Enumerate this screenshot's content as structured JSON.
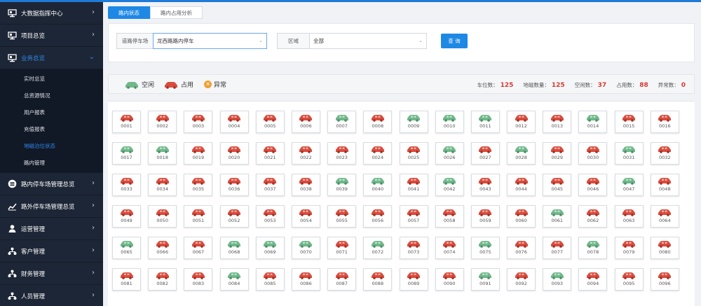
{
  "colors": {
    "occupied": "#d94b3c",
    "free": "#6fb88a",
    "accent": "#1e88e5",
    "sidebar_bg": "#1d2636"
  },
  "sidebar": {
    "items": [
      {
        "label": "大数据指挥中心",
        "icon": "monitor-icon"
      },
      {
        "label": "项目总览",
        "icon": "monitor-icon"
      },
      {
        "label": "业务总览",
        "icon": "monitor-icon",
        "active": true
      }
    ],
    "sub_items": [
      {
        "label": "实时总览"
      },
      {
        "label": "总资源情况"
      },
      {
        "label": "用户报表"
      },
      {
        "label": "充值报表"
      },
      {
        "label": "地磁泊位状态",
        "active": true
      },
      {
        "label": "路内管理"
      }
    ],
    "items_after": [
      {
        "label": "路内停车场管理总览",
        "icon": "parking-icon"
      },
      {
        "label": "路外停车场管理总览",
        "icon": "chart-icon"
      },
      {
        "label": "运营管理",
        "icon": "operator-icon"
      },
      {
        "label": "客户管理",
        "icon": "org-icon"
      },
      {
        "label": "财务管理",
        "icon": "org-icon"
      },
      {
        "label": "人员管理",
        "icon": "org-icon"
      }
    ]
  },
  "tabs": [
    "路内状态",
    "路内占用分析"
  ],
  "filter": {
    "lot_label": "道路停车场",
    "lot_value": "龙西路路内停车",
    "area_label": "区域",
    "area_value": "全部",
    "query_label": "查 询"
  },
  "legend": {
    "free": "空闲",
    "occupied": "占用",
    "abnormal": "异常"
  },
  "stats": {
    "spaces_label": "车位数：",
    "spaces": "125",
    "sensors_label": "地磁数量：",
    "sensors": "125",
    "free_label": "空闲数：",
    "free": "37",
    "occupied_label": "占用数：",
    "occupied": "88",
    "abnormal_label": "异常数：",
    "abnormal": "0"
  },
  "spots": [
    {
      "id": "0001",
      "s": "o"
    },
    {
      "id": "0002",
      "s": "o"
    },
    {
      "id": "0003",
      "s": "o"
    },
    {
      "id": "0004",
      "s": "o"
    },
    {
      "id": "0005",
      "s": "o"
    },
    {
      "id": "0006",
      "s": "o"
    },
    {
      "id": "0007",
      "s": "f"
    },
    {
      "id": "0008",
      "s": "o"
    },
    {
      "id": "0009",
      "s": "f"
    },
    {
      "id": "0010",
      "s": "f"
    },
    {
      "id": "0011",
      "s": "f"
    },
    {
      "id": "0012",
      "s": "o"
    },
    {
      "id": "0013",
      "s": "o"
    },
    {
      "id": "0014",
      "s": "f"
    },
    {
      "id": "0015",
      "s": "o"
    },
    {
      "id": "0016",
      "s": "o"
    },
    {
      "id": "0017",
      "s": "f"
    },
    {
      "id": "0018",
      "s": "f"
    },
    {
      "id": "0019",
      "s": "o"
    },
    {
      "id": "0020",
      "s": "o"
    },
    {
      "id": "0021",
      "s": "o"
    },
    {
      "id": "0022",
      "s": "o"
    },
    {
      "id": "0023",
      "s": "o"
    },
    {
      "id": "0024",
      "s": "o"
    },
    {
      "id": "0025",
      "s": "o"
    },
    {
      "id": "0026",
      "s": "f"
    },
    {
      "id": "0027",
      "s": "o"
    },
    {
      "id": "0028",
      "s": "f"
    },
    {
      "id": "0029",
      "s": "o"
    },
    {
      "id": "0030",
      "s": "o"
    },
    {
      "id": "0031",
      "s": "f"
    },
    {
      "id": "0032",
      "s": "o"
    },
    {
      "id": "0033",
      "s": "o"
    },
    {
      "id": "0034",
      "s": "o"
    },
    {
      "id": "0035",
      "s": "o"
    },
    {
      "id": "0036",
      "s": "o"
    },
    {
      "id": "0037",
      "s": "o"
    },
    {
      "id": "0038",
      "s": "o"
    },
    {
      "id": "0039",
      "s": "f"
    },
    {
      "id": "0040",
      "s": "f"
    },
    {
      "id": "0041",
      "s": "o"
    },
    {
      "id": "0042",
      "s": "f"
    },
    {
      "id": "0043",
      "s": "o"
    },
    {
      "id": "0044",
      "s": "o"
    },
    {
      "id": "0045",
      "s": "o"
    },
    {
      "id": "0046",
      "s": "o"
    },
    {
      "id": "0047",
      "s": "f"
    },
    {
      "id": "0048",
      "s": "o"
    },
    {
      "id": "0049",
      "s": "o"
    },
    {
      "id": "0050",
      "s": "o"
    },
    {
      "id": "0051",
      "s": "o"
    },
    {
      "id": "0052",
      "s": "o"
    },
    {
      "id": "0053",
      "s": "o"
    },
    {
      "id": "0054",
      "s": "o"
    },
    {
      "id": "0055",
      "s": "o"
    },
    {
      "id": "0056",
      "s": "o"
    },
    {
      "id": "0057",
      "s": "o"
    },
    {
      "id": "0058",
      "s": "o"
    },
    {
      "id": "0059",
      "s": "o"
    },
    {
      "id": "0060",
      "s": "o"
    },
    {
      "id": "0061",
      "s": "f"
    },
    {
      "id": "0062",
      "s": "o"
    },
    {
      "id": "0063",
      "s": "o"
    },
    {
      "id": "0064",
      "s": "o"
    },
    {
      "id": "0065",
      "s": "f"
    },
    {
      "id": "0066",
      "s": "o"
    },
    {
      "id": "0067",
      "s": "o"
    },
    {
      "id": "0068",
      "s": "f"
    },
    {
      "id": "0069",
      "s": "f"
    },
    {
      "id": "0070",
      "s": "f"
    },
    {
      "id": "0071",
      "s": "o"
    },
    {
      "id": "0072",
      "s": "f"
    },
    {
      "id": "0073",
      "s": "o"
    },
    {
      "id": "0074",
      "s": "o"
    },
    {
      "id": "0075",
      "s": "f"
    },
    {
      "id": "0076",
      "s": "o"
    },
    {
      "id": "0077",
      "s": "o"
    },
    {
      "id": "0078",
      "s": "f"
    },
    {
      "id": "0079",
      "s": "o"
    },
    {
      "id": "0080",
      "s": "o"
    },
    {
      "id": "0081",
      "s": "o"
    },
    {
      "id": "0082",
      "s": "o"
    },
    {
      "id": "0083",
      "s": "o"
    },
    {
      "id": "0084",
      "s": "f"
    },
    {
      "id": "0085",
      "s": "o"
    },
    {
      "id": "0086",
      "s": "o"
    },
    {
      "id": "0087",
      "s": "o"
    },
    {
      "id": "0088",
      "s": "o"
    },
    {
      "id": "0089",
      "s": "o"
    },
    {
      "id": "0090",
      "s": "o"
    },
    {
      "id": "0091",
      "s": "f"
    },
    {
      "id": "0092",
      "s": "o"
    },
    {
      "id": "0093",
      "s": "f"
    },
    {
      "id": "0094",
      "s": "o"
    },
    {
      "id": "0095",
      "s": "o"
    },
    {
      "id": "0096",
      "s": "o"
    }
  ]
}
